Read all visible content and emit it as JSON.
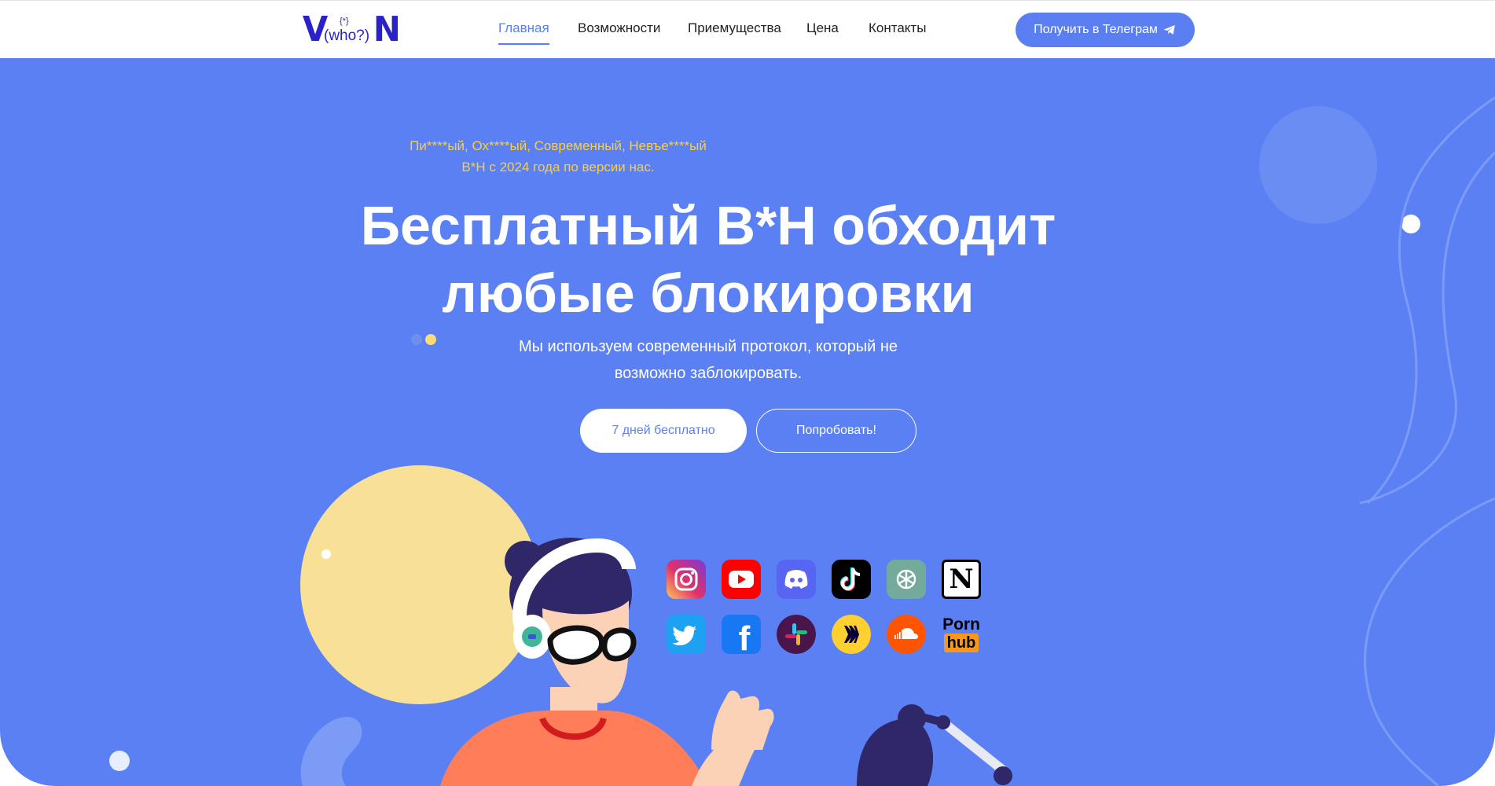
{
  "header": {
    "logo": {
      "left": "V",
      "right": "N",
      "middle": "(who?)",
      "top": "{*}"
    },
    "nav": [
      {
        "label": "Главная",
        "active": true
      },
      {
        "label": "Возможности",
        "active": false
      },
      {
        "label": "Приемущества",
        "active": false
      },
      {
        "label": "Цена",
        "active": false
      },
      {
        "label": "Контакты",
        "active": false
      }
    ],
    "cta_label": "Получить в Телеграм",
    "cta_icon": "telegram-icon"
  },
  "hero": {
    "tagline_line1": "Пи****ый, Ох****ый, Современный, Невъе****ый",
    "tagline_line2": "В*Н с 2024 года по версии нас.",
    "title_line1": "Бесплатный В*Н обходит",
    "title_line2": "любые блокировки",
    "subtitle_line1": "Мы используем современный протокол, который не",
    "subtitle_line2": "возможно заблокировать.",
    "btn_primary": "7 дней бесплатно",
    "btn_secondary": "Попробовать!"
  },
  "apps": [
    {
      "name": "instagram-icon"
    },
    {
      "name": "youtube-icon"
    },
    {
      "name": "discord-icon"
    },
    {
      "name": "tiktok-icon"
    },
    {
      "name": "chatgpt-icon"
    },
    {
      "name": "notion-icon",
      "glyph": "N"
    },
    {
      "name": "twitter-icon"
    },
    {
      "name": "facebook-icon",
      "glyph": "f"
    },
    {
      "name": "slack-icon"
    },
    {
      "name": "miro-icon"
    },
    {
      "name": "soundcloud-icon"
    },
    {
      "name": "pornhub-icon",
      "line1": "Porn",
      "line2": "hub"
    }
  ],
  "colors": {
    "accent": "#5b7ff2",
    "hero_bg": "#5a80f3",
    "tagline": "#f5cf4e",
    "logo": "#2a22c9"
  }
}
